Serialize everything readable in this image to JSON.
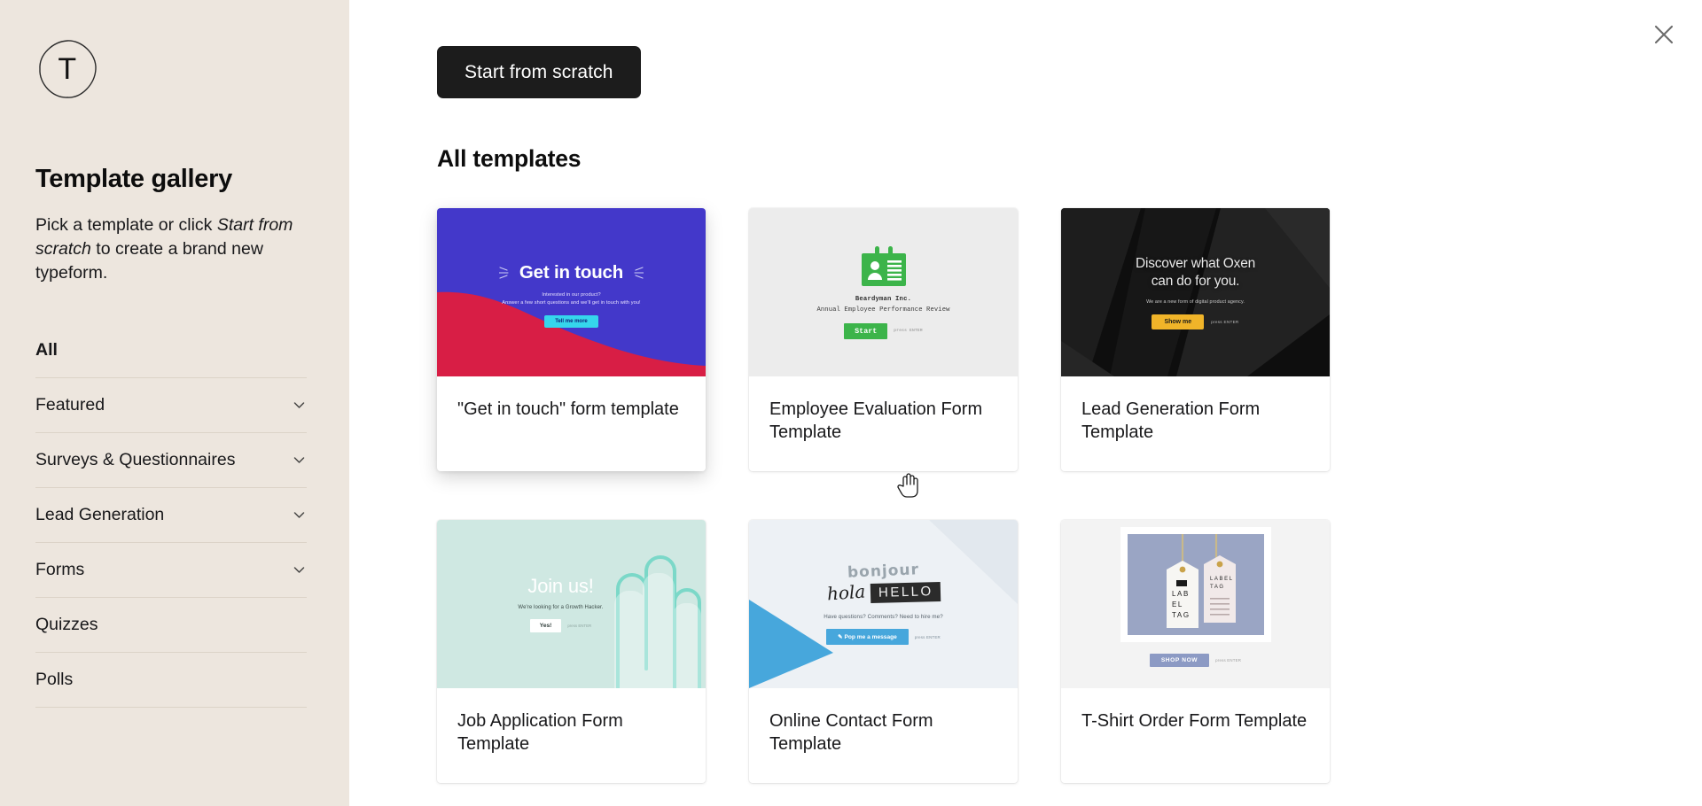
{
  "sidebar": {
    "logo_letter": "T",
    "title": "Template gallery",
    "description_parts": {
      "p1": "Pick a template or click ",
      "em1": "Start from scratch",
      "p2": " to create a brand new typeform."
    },
    "nav_items": [
      {
        "label": "All",
        "active": true,
        "has_chevron": false
      },
      {
        "label": "Featured",
        "active": false,
        "has_chevron": true
      },
      {
        "label": "Surveys & Questionnaires",
        "active": false,
        "has_chevron": true
      },
      {
        "label": "Lead Generation",
        "active": false,
        "has_chevron": true
      },
      {
        "label": "Forms",
        "active": false,
        "has_chevron": true
      },
      {
        "label": "Quizzes",
        "active": false,
        "has_chevron": false
      },
      {
        "label": "Polls",
        "active": false,
        "has_chevron": false
      }
    ]
  },
  "main": {
    "close_label": "×",
    "start_from_scratch_label": "Start from scratch",
    "section_title": "All templates",
    "cards": [
      {
        "title": "\"Get in touch\" form template",
        "hovered": true,
        "thumb": {
          "style": "get-in-touch",
          "heading": "Get in touch",
          "subtitle_line1": "Interested in our product?",
          "subtitle_line2": "Answer a few short questions and we'll get in touch with you!",
          "button": "Tell me more",
          "bg_color": "#4338CA",
          "accent_color": "#D81E45",
          "button_color": "#35D6EC"
        }
      },
      {
        "title": "Employee Evaluation Form Template",
        "hovered": false,
        "thumb": {
          "style": "employee-evaluation",
          "company": "Beardyman Inc.",
          "subtitle": "Annual Employee Performance Review",
          "button": "Start",
          "hint": "press ENTER",
          "bg_color": "#ECECEC",
          "accent_color": "#3CB44A"
        }
      },
      {
        "title": "Lead Generation Form Template",
        "hovered": false,
        "thumb": {
          "style": "lead-generation",
          "heading_line1": "Discover what Oxen",
          "heading_line2": "can do for you.",
          "subtitle": "We are a new form of digital product agency.",
          "button": "Show me",
          "hint": "press ENTER",
          "bg_color": "#0E0E0E",
          "button_color": "#F0B429"
        }
      },
      {
        "title": "Job Application Form Template",
        "hovered": false,
        "thumb": {
          "style": "job-application",
          "heading": "Join us!",
          "subtitle": "We're looking for a Growth Hacker.",
          "button": "Yes!",
          "hint": "press ENTER",
          "bg_color": "#CFE8E2",
          "accent_color": "#5FD3C0"
        }
      },
      {
        "title": "Online Contact Form Template",
        "hovered": false,
        "thumb": {
          "style": "online-contact",
          "word1": "bonjour",
          "word2": "hola",
          "word3": "HELLO",
          "subtitle": "Have questions? Comments? Need to hire me?",
          "button": "✎ Pop me a message",
          "hint": "press ENTER",
          "bg_color": "#EDF1F5",
          "accent_color": "#47A7DC"
        }
      },
      {
        "title": "T-Shirt Order Form Template",
        "hovered": false,
        "thumb": {
          "style": "tshirt-order",
          "tag1_line1": "LAB",
          "tag1_line2": "EL",
          "tag1_line3": "TAG",
          "tag2_line1": "LABEL",
          "tag2_line2": "TAG",
          "button": "SHOP NOW",
          "hint": "press ENTER",
          "bg_color": "#F3F3F3",
          "accent_color": "#8C9AC4"
        }
      }
    ]
  }
}
